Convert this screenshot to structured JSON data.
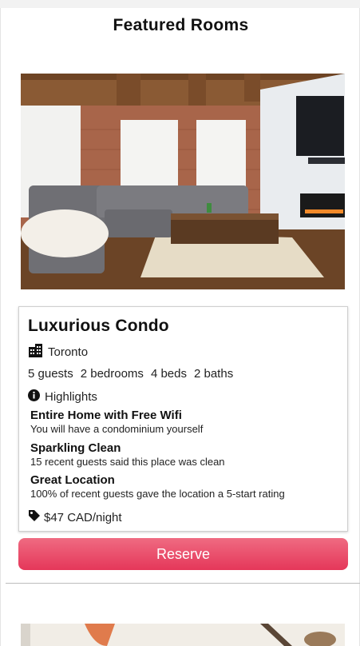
{
  "page": {
    "title": "Featured Rooms"
  },
  "listing": {
    "name": "Luxurious Condo",
    "location_icon": "building-icon",
    "location": "Toronto",
    "stats": {
      "guests": "5 guests",
      "bedrooms": "2 bedrooms",
      "beds": "4 beds",
      "baths": "2 baths"
    },
    "highlights_icon": "info-circle-icon",
    "highlights_label": "Highlights",
    "features": [
      {
        "title": "Entire Home with Free Wifi",
        "desc": "You will have a condominium yourself"
      },
      {
        "title": "Sparkling Clean",
        "desc": "15 recent guests said this place was clean"
      },
      {
        "title": "Great Location",
        "desc": "100% of recent guests gave the location a 5-start rating"
      }
    ],
    "price_icon": "tag-icon",
    "price": "$47 CAD/night"
  },
  "actions": {
    "reserve_label": "Reserve"
  },
  "colors": {
    "reserve_top": "#ef6b82",
    "reserve_bottom": "#e5375a"
  }
}
